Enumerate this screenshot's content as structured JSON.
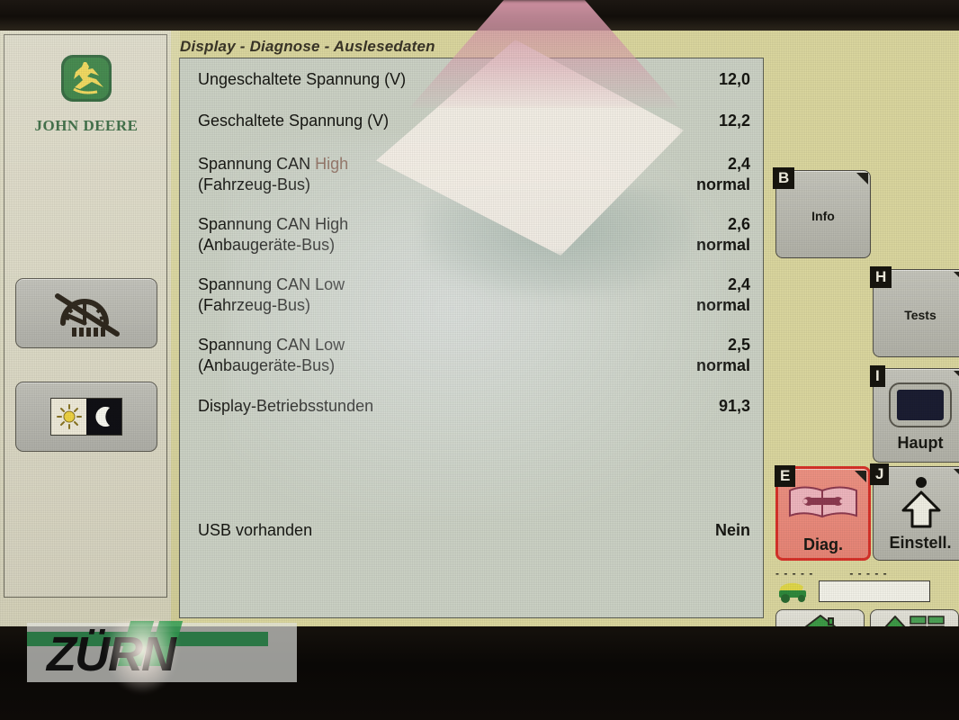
{
  "device": {
    "brand": "JOHN DEERE",
    "watermark": "ZÜRN"
  },
  "sidebar": {
    "buttons": [
      {
        "name": "gauge-disabled",
        "icon": "gauge-crossed-out-icon",
        "label": ""
      },
      {
        "name": "day-night",
        "icon": "sun-moon-icon",
        "label": ""
      }
    ]
  },
  "main": {
    "title": "Display - Diagnose - Auslesedaten",
    "rows": [
      {
        "label": "Ungeschaltete Spannung (V)",
        "label_hl": "",
        "value": "12,0",
        "status": ""
      },
      {
        "label": "Geschaltete Spannung (V)",
        "label_hl": "",
        "value": "12,2",
        "status": ""
      },
      {
        "label": "Spannung CAN ",
        "label_hl": "High",
        "label2": "(Fahrzeug-Bus)",
        "value": "2,4",
        "status": "normal"
      },
      {
        "label": "Spannung CAN High",
        "label_hl": "",
        "label2": "(Anbaugeräte-Bus)",
        "value": "2,6",
        "status": "normal"
      },
      {
        "label": "Spannung CAN Low",
        "label_hl": "",
        "label2": "(Fahrzeug-Bus)",
        "value": "2,4",
        "status": "normal"
      },
      {
        "label": "Spannung CAN Low",
        "label_hl": "",
        "label2": "(Anbaugeräte-Bus)",
        "value": "2,5",
        "status": "normal"
      },
      {
        "label": "Display-Betriebsstunden",
        "label_hl": "",
        "value": "91,3",
        "status": ""
      },
      {
        "label": "USB vorhanden",
        "label_hl": "",
        "value": "Nein",
        "status": ""
      }
    ]
  },
  "softkeys": [
    {
      "tag": "B",
      "label": "Info",
      "icon": "",
      "selected": false
    },
    {
      "tag": "H",
      "label": "Tests",
      "icon": "",
      "selected": false
    },
    {
      "tag": "I",
      "label": "Haupt",
      "icon": "display-screen-icon",
      "selected": false
    },
    {
      "tag": "E",
      "label": "Diag.",
      "icon": "book-wrench-icon",
      "selected": true
    },
    {
      "tag": "J",
      "label": "Einstell.",
      "icon": "up-arrow-dot-icon",
      "selected": false
    }
  ],
  "statusbar": {
    "dash_left": "- - - - -",
    "dash_right": "- - - - -",
    "machine_icon": "tractor-icon",
    "field_value": ""
  },
  "bottombar": [
    {
      "name": "home",
      "icon": "home-icon"
    },
    {
      "name": "page-up-list",
      "icon": "up-arrow-list-icon"
    }
  ],
  "colors": {
    "screen_bg": "#dcd8a0",
    "panel_bg": "#cdd3c6",
    "sidebar_bg": "#dedbc7",
    "accent_red": "#d8322a",
    "jd_green": "#2d6236",
    "zurn_green": "#1d7a3d"
  }
}
